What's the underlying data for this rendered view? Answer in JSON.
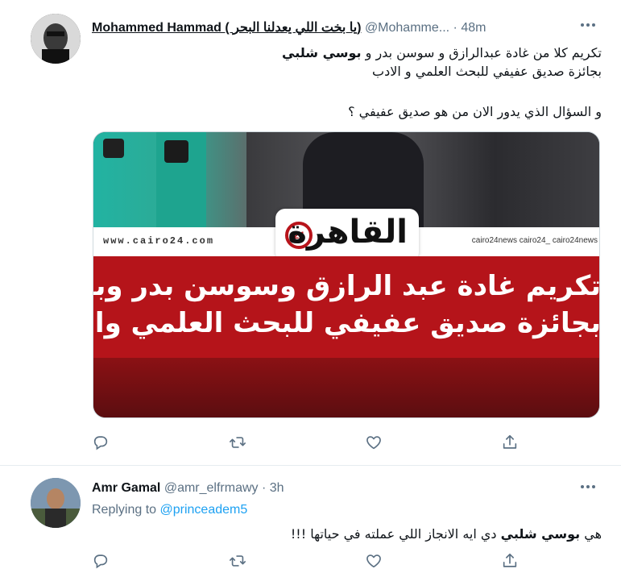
{
  "tweets": [
    {
      "author_name": "Mohammed Hammad ( يا بخت اللي يعدلنا البحر)",
      "handle": "@Mohamme...",
      "separator": "·",
      "time": "48m",
      "text_line1_a": "تكريم  كلا من  غادة عبدالرازق و سوسن بدر و ",
      "text_line1_b": "بوسي شلبي",
      "text_line2": "بجائزة صديق عفيفي للبحث العلمي و الادب",
      "text_line3": "و السؤال الذي يدور الان  من هو صديق عفيفي ؟",
      "media": {
        "url_text": "www.cairo24.com",
        "social_text": "cairo24news  cairo24_  cairo24news",
        "logo_badge": "24",
        "logo_word": "القاهرة",
        "headline_line1": "تكريم غادة عبد الرازق وسوسن بدر وبوسي شلبي",
        "headline_line2": "بجائزة صديق عفيفي للبحث العلمي والأدب"
      }
    },
    {
      "author_name": "Amr Gamal",
      "handle": "@amr_elfrmawy",
      "separator": "·",
      "time": "3h",
      "replying_label": "Replying to ",
      "replying_handle": "@princeadem5",
      "text_a": "هي ",
      "text_b": "بوسي شلبي",
      "text_c": " دي ايه الانجاز اللي عملته في حياتها !!!"
    }
  ],
  "icons": {
    "reply": "reply-icon",
    "retweet": "retweet-icon",
    "like": "heart-icon",
    "share": "share-icon",
    "more": "more-options-icon"
  },
  "colors": {
    "link": "#1da1f2",
    "secondary_text": "#5b7083",
    "icon": "#5b7083",
    "brand_red": "#b5141a"
  }
}
